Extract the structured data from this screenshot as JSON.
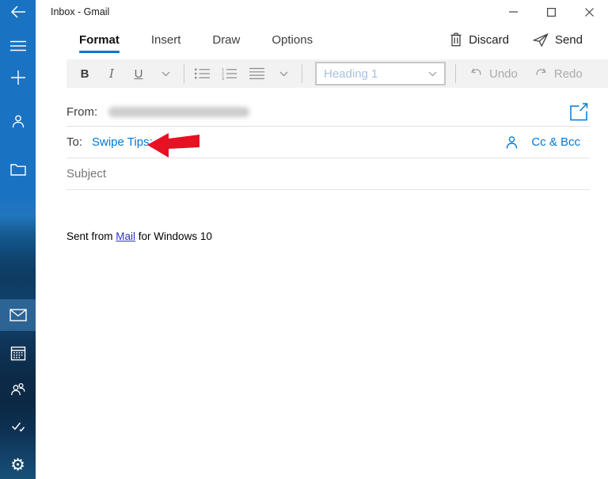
{
  "window": {
    "title": "Inbox - Gmail"
  },
  "window_controls": {
    "minimize": "minimize-icon",
    "maximize": "maximize-icon",
    "close": "close-icon"
  },
  "sidebar": {
    "icons": [
      "back-arrow",
      "hamburger-menu",
      "new-plus",
      "person-account",
      "folder",
      "mail-envelope",
      "calendar",
      "people",
      "tasks-checks",
      "settings-gear"
    ],
    "selected_item": "mail"
  },
  "tabs": {
    "items": [
      {
        "label": "Format",
        "active": true
      },
      {
        "label": "Insert",
        "active": false
      },
      {
        "label": "Draw",
        "active": false
      },
      {
        "label": "Options",
        "active": false
      }
    ]
  },
  "actions": {
    "discard": "Discard",
    "send": "Send"
  },
  "format_toolbar": {
    "bold": "B",
    "italic": "I",
    "underline": "U",
    "style_selector": "Heading 1",
    "undo": "Undo",
    "redo": "Redo"
  },
  "compose": {
    "from_label": "From:",
    "to_label": "To:",
    "to_recipient": "Swipe Tips;",
    "cc_bcc_label": "Cc & Bcc",
    "subject_placeholder": "Subject",
    "signature": {
      "prefix": "Sent from ",
      "link": "Mail",
      "suffix": " for Windows 10"
    }
  },
  "colors": {
    "accent": "#0078d7",
    "sidebar_top": "#1a72c2",
    "toolbar_bg": "#f2f2f2",
    "heading_placeholder_text": "#a9c0de",
    "annotation_arrow_red": "#e81123",
    "signature_link_blue": "#3030d0"
  }
}
